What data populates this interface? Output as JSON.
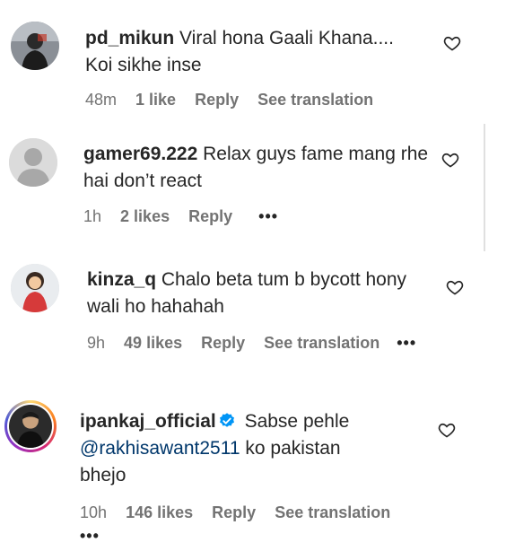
{
  "comments": [
    {
      "username": "pd_mikun",
      "text": "Viral hona Gaali Khana.... Koi sikhe inse",
      "time": "48m",
      "likes": "1 like",
      "reply": "Reply",
      "translation": "See translation",
      "more": ""
    },
    {
      "username": "gamer69.222",
      "text": "Relax guys fame mang rhe hai don’t react",
      "time": "1h",
      "likes": "2 likes",
      "reply": "Reply",
      "translation": "",
      "more": "•••"
    },
    {
      "username": "kinza_q",
      "text": "Chalo beta tum b bycott hony wali ho hahahah",
      "time": "9h",
      "likes": "49 likes",
      "reply": "Reply",
      "translation": "See translation",
      "more": "•••"
    },
    {
      "username": "ipankaj_official",
      "text_before": "Sabse pehle",
      "mention": "@rakhisawant2511",
      "text_after": "ko pakistan bhejo",
      "time": "10h",
      "likes": "146 likes",
      "reply": "Reply",
      "translation": "See translation",
      "more": "•••"
    }
  ],
  "colors": {
    "text": "#262626",
    "meta": "#737373",
    "mention": "#00376b",
    "verified": "#0095f6"
  },
  "icons": {
    "like": "heart-outline-icon",
    "verified": "verified-badge-icon",
    "more": "more-options-icon"
  }
}
